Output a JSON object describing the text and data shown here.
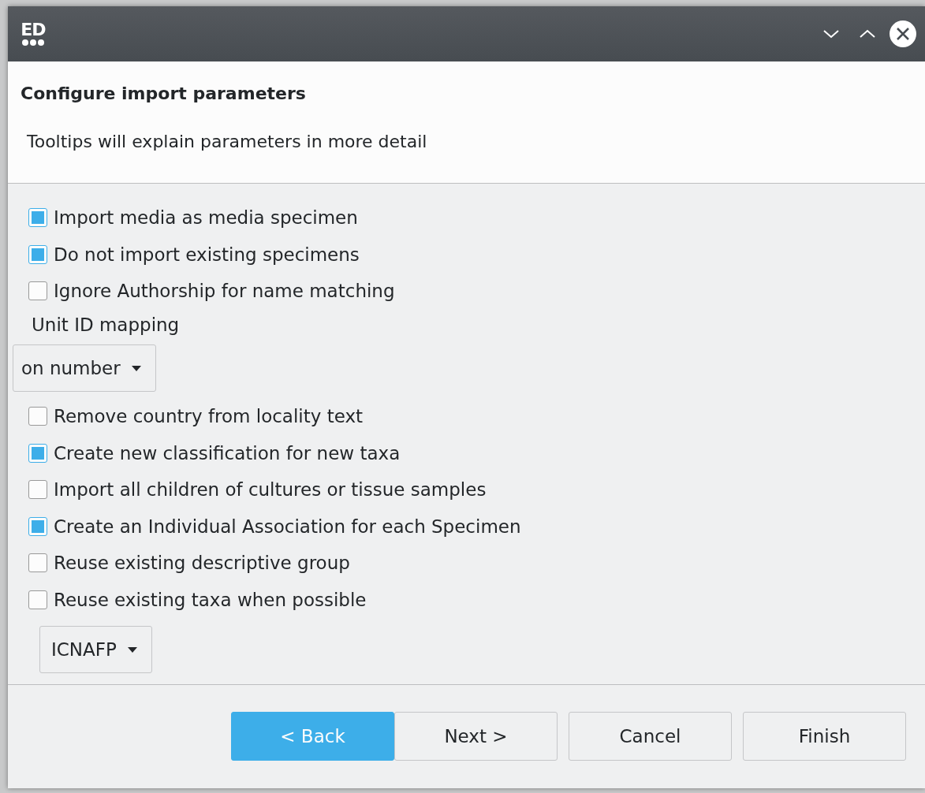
{
  "window": {
    "logo_text": "ED"
  },
  "header": {
    "title": "Configure import parameters",
    "description": "Tooltips will explain parameters in more detail"
  },
  "options": [
    {
      "kind": "checkbox",
      "label": "Import media as media specimen",
      "checked": true
    },
    {
      "kind": "checkbox",
      "label": "Do not import existing specimens",
      "checked": true
    },
    {
      "kind": "checkbox",
      "label": "Ignore Authorship for name matching",
      "checked": false
    },
    {
      "kind": "label",
      "label": "Unit ID mapping"
    },
    {
      "kind": "dropdown",
      "value": "on number"
    },
    {
      "kind": "checkbox",
      "label": "Remove country from locality text",
      "checked": false
    },
    {
      "kind": "checkbox",
      "label": "Create new classification for new taxa",
      "checked": true
    },
    {
      "kind": "checkbox",
      "label": "Import all children of cultures or tissue samples",
      "checked": false
    },
    {
      "kind": "checkbox",
      "label": "Create an Individual Association for each Specimen",
      "checked": true
    },
    {
      "kind": "checkbox",
      "label": "Reuse existing descriptive group",
      "checked": false
    },
    {
      "kind": "checkbox",
      "label": "Reuse existing taxa when possible",
      "checked": false
    },
    {
      "kind": "dropdown",
      "value": "ICNAFP"
    }
  ],
  "buttons": [
    {
      "label": "< Back",
      "focused": true
    },
    {
      "label": "Next >",
      "focused": false
    },
    {
      "label": "Cancel",
      "focused": false
    },
    {
      "label": "Finish",
      "focused": false
    }
  ]
}
